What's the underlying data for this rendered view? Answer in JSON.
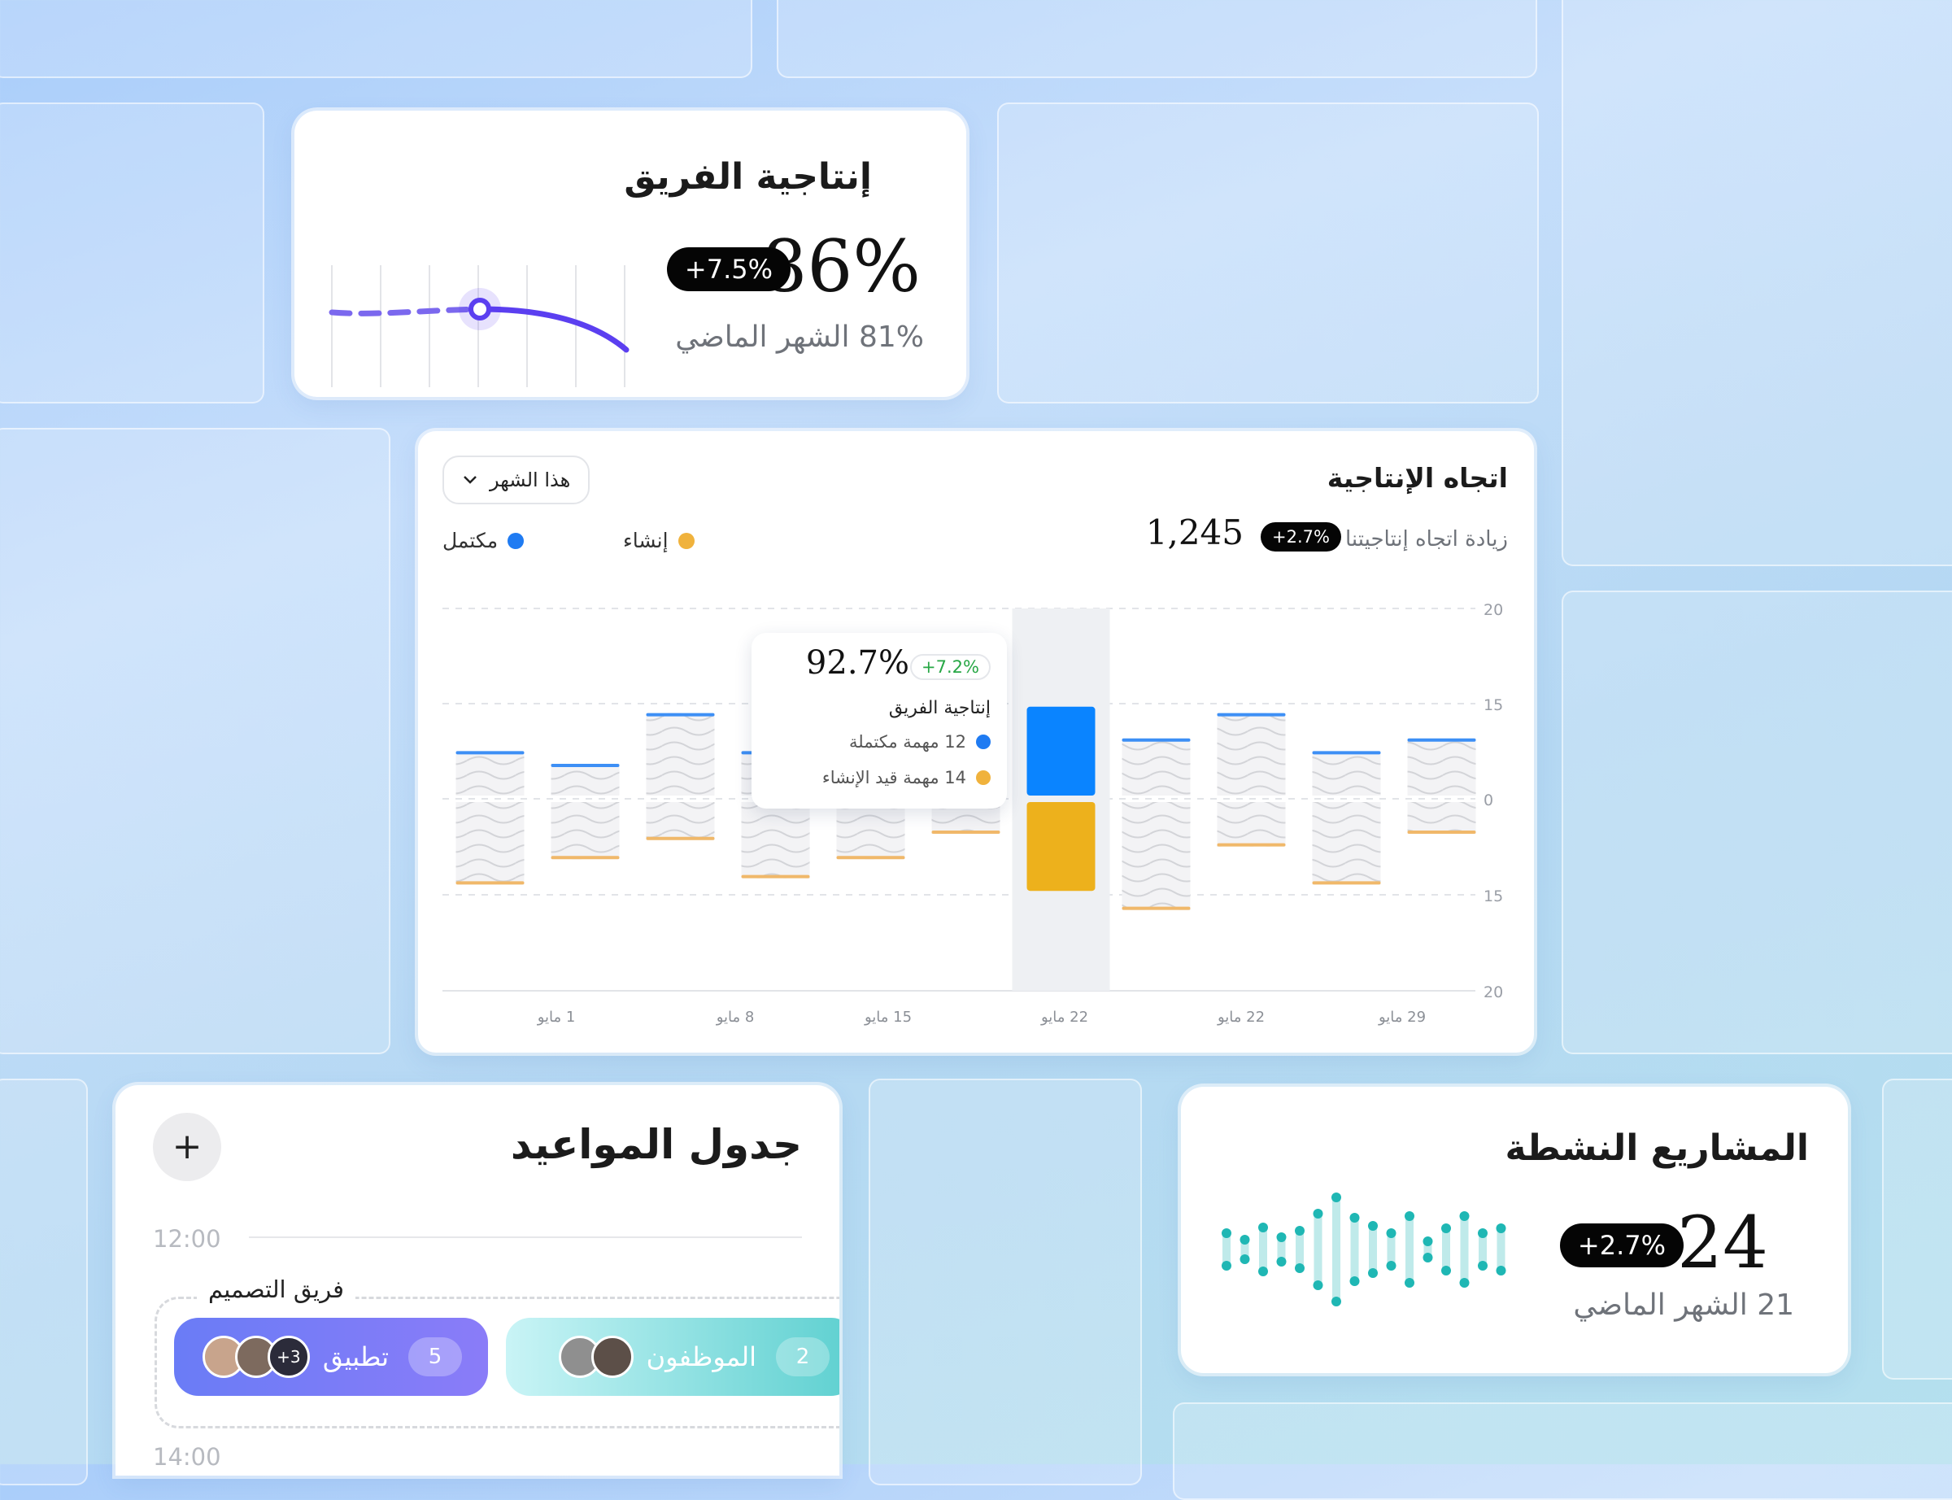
{
  "productivity_card": {
    "title": "إنتاجية الفريق",
    "value": "86%",
    "badge": "+7.5%",
    "previous": "81% الشهر الماضي",
    "accent": "#5b3ff0"
  },
  "trend_card": {
    "title": "اتجاه الإنتاجية",
    "subtitle": "زيادة اتجاه إنتاجيتنا",
    "badge": "+2.7%",
    "total": "1,245",
    "period_select": "هذا الشهر",
    "period_icon": "chevron-down-icon",
    "legend": [
      {
        "label": "مكتمل",
        "color": "#1f7bf2"
      },
      {
        "label": "إنشاء",
        "color": "#f0b23c"
      }
    ],
    "tooltip": {
      "value": "92.7%",
      "change": "+7.2%",
      "label": "إنتاجية الفريق",
      "completed": "12 مهمة مكتملة",
      "creating": "14 مهمة قيد الإنشاء"
    }
  },
  "chart_data": {
    "type": "bar",
    "title": "اتجاه الإنتاجية",
    "y_ticks": [
      "20",
      "15",
      "0",
      "15",
      "20"
    ],
    "x_tick_labels": [
      "1 مايو",
      "8 مايو",
      "15 مايو",
      "22 مايو",
      "22 مايو",
      "29 مايو"
    ],
    "highlighted_index": 6,
    "series": [
      {
        "name": "مكتمل",
        "color": "#0a84ff",
        "values": [
          7,
          5,
          13,
          7,
          8,
          9,
          14,
          9,
          13,
          7,
          9
        ]
      },
      {
        "name": "إنشاء",
        "color": "#edb11c",
        "values": [
          13,
          9,
          6,
          12,
          9,
          5,
          14,
          17,
          7,
          13,
          5
        ]
      }
    ]
  },
  "schedule_card": {
    "title": "جدول المواعيد",
    "add_label": "+",
    "times": [
      "12:00",
      "14:00"
    ],
    "group": "فريق التصميم",
    "events": [
      {
        "label": "تطبيق",
        "count": "5",
        "extra": "+3"
      },
      {
        "label": "الموظفون",
        "count": "2"
      }
    ]
  },
  "projects_card": {
    "title": "المشاريع النشطة",
    "value": "24",
    "badge": "+2.7%",
    "previous": "21 الشهر الماضي",
    "accent": "#1fb7b4"
  }
}
